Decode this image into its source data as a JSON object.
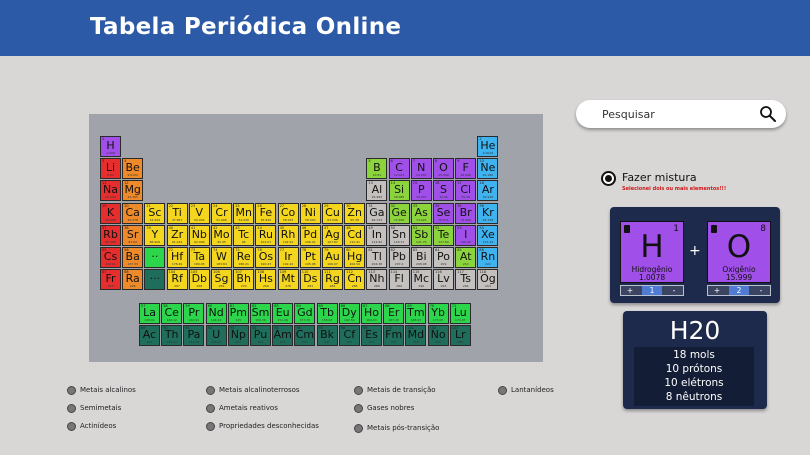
{
  "app": {
    "title": "Tabela Periódica Online"
  },
  "search": {
    "placeholder": "Pesquisar"
  },
  "colors": {
    "header": "#2d5aa6",
    "page_bg": "#d9d6d6",
    "table_panel": "#a1a3ab",
    "mix_panel": "#1e2a4b",
    "categories": {
      "reactive_nonmetal": "#a04fe8",
      "alkali": "#e72e2e",
      "alkaline_earth": "#ef8a2a",
      "transition": "#f5d61f",
      "post_transition": "#c4c0bd",
      "metalloid": "#8cd43c",
      "halogen": "#a04fe8",
      "noble_gas": "#3fb3f0",
      "lanthanide": "#2bd64a",
      "actinide": "#1f6e5c",
      "unknown": "#2ab650"
    }
  },
  "periodic_table": {
    "main": [
      {
        "z": 1,
        "s": "H",
        "m": "1.008",
        "c": "reactive_nonmetal",
        "col": 1,
        "row": 1
      },
      {
        "z": 2,
        "s": "He",
        "m": "4.0026",
        "c": "noble_gas",
        "col": 18,
        "row": 1
      },
      {
        "z": 3,
        "s": "Li",
        "m": "6.94",
        "c": "alkali",
        "col": 1,
        "row": 2
      },
      {
        "z": 4,
        "s": "Be",
        "m": "9.0122",
        "c": "alkaline_earth",
        "col": 2,
        "row": 2
      },
      {
        "z": 5,
        "s": "B",
        "m": "10.81",
        "c": "metalloid",
        "col": 13,
        "row": 2
      },
      {
        "z": 6,
        "s": "C",
        "m": "12.011",
        "c": "reactive_nonmetal",
        "col": 14,
        "row": 2
      },
      {
        "z": 7,
        "s": "N",
        "m": "14.007",
        "c": "reactive_nonmetal",
        "col": 15,
        "row": 2
      },
      {
        "z": 8,
        "s": "O",
        "m": "15.999",
        "c": "reactive_nonmetal",
        "col": 16,
        "row": 2
      },
      {
        "z": 9,
        "s": "F",
        "m": "18.998",
        "c": "halogen",
        "col": 17,
        "row": 2
      },
      {
        "z": 10,
        "s": "Ne",
        "m": "20.180",
        "c": "noble_gas",
        "col": 18,
        "row": 2
      },
      {
        "z": 11,
        "s": "Na",
        "m": "22.990",
        "c": "alkali",
        "col": 1,
        "row": 3
      },
      {
        "z": 12,
        "s": "Mg",
        "m": "24.305",
        "c": "alkaline_earth",
        "col": 2,
        "row": 3
      },
      {
        "z": 13,
        "s": "Al",
        "m": "26.982",
        "c": "post_transition",
        "col": 13,
        "row": 3
      },
      {
        "z": 14,
        "s": "Si",
        "m": "28.085",
        "c": "metalloid",
        "col": 14,
        "row": 3
      },
      {
        "z": 15,
        "s": "P",
        "m": "30.974",
        "c": "reactive_nonmetal",
        "col": 15,
        "row": 3
      },
      {
        "z": 16,
        "s": "S",
        "m": "32.06",
        "c": "reactive_nonmetal",
        "col": 16,
        "row": 3
      },
      {
        "z": 17,
        "s": "Cl",
        "m": "35.45",
        "c": "halogen",
        "col": 17,
        "row": 3
      },
      {
        "z": 18,
        "s": "Ar",
        "m": "39.948",
        "c": "noble_gas",
        "col": 18,
        "row": 3
      },
      {
        "z": 19,
        "s": "K",
        "m": "39.098",
        "c": "alkali",
        "col": 1,
        "row": 4
      },
      {
        "z": 20,
        "s": "Ca",
        "m": "40.078",
        "c": "alkaline_earth",
        "col": 2,
        "row": 4
      },
      {
        "z": 21,
        "s": "Sc",
        "m": "44.956",
        "c": "transition",
        "col": 3,
        "row": 4
      },
      {
        "z": 22,
        "s": "Ti",
        "m": "47.867",
        "c": "transition",
        "col": 4,
        "row": 4
      },
      {
        "z": 23,
        "s": "V",
        "m": "50.942",
        "c": "transition",
        "col": 5,
        "row": 4
      },
      {
        "z": 24,
        "s": "Cr",
        "m": "51.996",
        "c": "transition",
        "col": 6,
        "row": 4
      },
      {
        "z": 25,
        "s": "Mn",
        "m": "54.938",
        "c": "transition",
        "col": 7,
        "row": 4
      },
      {
        "z": 26,
        "s": "Fe",
        "m": "55.845",
        "c": "transition",
        "col": 8,
        "row": 4
      },
      {
        "z": 27,
        "s": "Co",
        "m": "58.933",
        "c": "transition",
        "col": 9,
        "row": 4
      },
      {
        "z": 28,
        "s": "Ni",
        "m": "58.693",
        "c": "transition",
        "col": 10,
        "row": 4
      },
      {
        "z": 29,
        "s": "Cu",
        "m": "63.546",
        "c": "transition",
        "col": 11,
        "row": 4
      },
      {
        "z": 30,
        "s": "Zn",
        "m": "65.38",
        "c": "transition",
        "col": 12,
        "row": 4
      },
      {
        "z": 31,
        "s": "Ga",
        "m": "69.723",
        "c": "post_transition",
        "col": 13,
        "row": 4
      },
      {
        "z": 32,
        "s": "Ge",
        "m": "72.630",
        "c": "metalloid",
        "col": 14,
        "row": 4
      },
      {
        "z": 33,
        "s": "As",
        "m": "74.922",
        "c": "metalloid",
        "col": 15,
        "row": 4
      },
      {
        "z": 34,
        "s": "Se",
        "m": "78.971",
        "c": "reactive_nonmetal",
        "col": 16,
        "row": 4
      },
      {
        "z": 35,
        "s": "Br",
        "m": "79.904",
        "c": "halogen",
        "col": 17,
        "row": 4
      },
      {
        "z": 36,
        "s": "Kr",
        "m": "83.798",
        "c": "noble_gas",
        "col": 18,
        "row": 4
      },
      {
        "z": 37,
        "s": "Rb",
        "m": "85.468",
        "c": "alkali",
        "col": 1,
        "row": 5
      },
      {
        "z": 38,
        "s": "Sr",
        "m": "87.62",
        "c": "alkaline_earth",
        "col": 2,
        "row": 5
      },
      {
        "z": 39,
        "s": "Y",
        "m": "88.906",
        "c": "transition",
        "col": 3,
        "row": 5
      },
      {
        "z": 40,
        "s": "Zr",
        "m": "91.224",
        "c": "transition",
        "col": 4,
        "row": 5
      },
      {
        "z": 41,
        "s": "Nb",
        "m": "92.906",
        "c": "transition",
        "col": 5,
        "row": 5
      },
      {
        "z": 42,
        "s": "Mo",
        "m": "95.95",
        "c": "transition",
        "col": 6,
        "row": 5
      },
      {
        "z": 43,
        "s": "Tc",
        "m": "98",
        "c": "transition",
        "col": 7,
        "row": 5
      },
      {
        "z": 44,
        "s": "Ru",
        "m": "101.07",
        "c": "transition",
        "col": 8,
        "row": 5
      },
      {
        "z": 45,
        "s": "Rh",
        "m": "102.91",
        "c": "transition",
        "col": 9,
        "row": 5
      },
      {
        "z": 46,
        "s": "Pd",
        "m": "106.42",
        "c": "transition",
        "col": 10,
        "row": 5
      },
      {
        "z": 47,
        "s": "Ag",
        "m": "107.87",
        "c": "transition",
        "col": 11,
        "row": 5
      },
      {
        "z": 48,
        "s": "Cd",
        "m": "112.41",
        "c": "transition",
        "col": 12,
        "row": 5
      },
      {
        "z": 49,
        "s": "In",
        "m": "114.82",
        "c": "post_transition",
        "col": 13,
        "row": 5
      },
      {
        "z": 50,
        "s": "Sn",
        "m": "118.71",
        "c": "post_transition",
        "col": 14,
        "row": 5
      },
      {
        "z": 51,
        "s": "Sb",
        "m": "121.76",
        "c": "metalloid",
        "col": 15,
        "row": 5
      },
      {
        "z": 52,
        "s": "Te",
        "m": "127.60",
        "c": "metalloid",
        "col": 16,
        "row": 5
      },
      {
        "z": 53,
        "s": "I",
        "m": "126.90",
        "c": "halogen",
        "col": 17,
        "row": 5
      },
      {
        "z": 54,
        "s": "Xe",
        "m": "131.29",
        "c": "noble_gas",
        "col": 18,
        "row": 5
      },
      {
        "z": 55,
        "s": "Cs",
        "m": "132.91",
        "c": "alkali",
        "col": 1,
        "row": 6
      },
      {
        "z": 56,
        "s": "Ba",
        "m": "137.33",
        "c": "alkaline_earth",
        "col": 2,
        "row": 6
      },
      {
        "z": "",
        "s": "··",
        "m": "",
        "c": "lanthanide",
        "col": 3,
        "row": 6
      },
      {
        "z": 72,
        "s": "Hf",
        "m": "178.49",
        "c": "transition",
        "col": 4,
        "row": 6
      },
      {
        "z": 73,
        "s": "Ta",
        "m": "180.95",
        "c": "transition",
        "col": 5,
        "row": 6
      },
      {
        "z": 74,
        "s": "W",
        "m": "183.84",
        "c": "transition",
        "col": 6,
        "row": 6
      },
      {
        "z": 75,
        "s": "Re",
        "m": "186.21",
        "c": "transition",
        "col": 7,
        "row": 6
      },
      {
        "z": 76,
        "s": "Os",
        "m": "190.23",
        "c": "transition",
        "col": 8,
        "row": 6
      },
      {
        "z": 77,
        "s": "Ir",
        "m": "192.22",
        "c": "transition",
        "col": 9,
        "row": 6
      },
      {
        "z": 78,
        "s": "Pt",
        "m": "195.08",
        "c": "transition",
        "col": 10,
        "row": 6
      },
      {
        "z": 79,
        "s": "Au",
        "m": "196.97",
        "c": "transition",
        "col": 11,
        "row": 6
      },
      {
        "z": 80,
        "s": "Hg",
        "m": "200.59",
        "c": "transition",
        "col": 12,
        "row": 6
      },
      {
        "z": 81,
        "s": "Tl",
        "m": "204.38",
        "c": "post_transition",
        "col": 13,
        "row": 6
      },
      {
        "z": 82,
        "s": "Pb",
        "m": "207.2",
        "c": "post_transition",
        "col": 14,
        "row": 6
      },
      {
        "z": 83,
        "s": "Bi",
        "m": "208.98",
        "c": "post_transition",
        "col": 15,
        "row": 6
      },
      {
        "z": 84,
        "s": "Po",
        "m": "209",
        "c": "post_transition",
        "col": 16,
        "row": 6
      },
      {
        "z": 85,
        "s": "At",
        "m": "210",
        "c": "metalloid",
        "col": 17,
        "row": 6
      },
      {
        "z": 86,
        "s": "Rn",
        "m": "222",
        "c": "noble_gas",
        "col": 18,
        "row": 6
      },
      {
        "z": 87,
        "s": "Fr",
        "m": "223",
        "c": "alkali",
        "col": 1,
        "row": 7
      },
      {
        "z": 88,
        "s": "Ra",
        "m": "226",
        "c": "alkaline_earth",
        "col": 2,
        "row": 7
      },
      {
        "z": "",
        "s": "···",
        "m": "",
        "c": "actinide",
        "col": 3,
        "row": 7
      },
      {
        "z": 104,
        "s": "Rf",
        "m": "267",
        "c": "transition",
        "col": 4,
        "row": 7
      },
      {
        "z": 105,
        "s": "Db",
        "m": "268",
        "c": "transition",
        "col": 5,
        "row": 7
      },
      {
        "z": 106,
        "s": "Sg",
        "m": "269",
        "c": "transition",
        "col": 6,
        "row": 7
      },
      {
        "z": 107,
        "s": "Bh",
        "m": "270",
        "c": "transition",
        "col": 7,
        "row": 7
      },
      {
        "z": 108,
        "s": "Hs",
        "m": "269",
        "c": "transition",
        "col": 8,
        "row": 7
      },
      {
        "z": 109,
        "s": "Mt",
        "m": "278",
        "c": "transition",
        "col": 9,
        "row": 7
      },
      {
        "z": 110,
        "s": "Ds",
        "m": "281",
        "c": "transition",
        "col": 10,
        "row": 7
      },
      {
        "z": 111,
        "s": "Rg",
        "m": "282",
        "c": "transition",
        "col": 11,
        "row": 7
      },
      {
        "z": 112,
        "s": "Cn",
        "m": "285",
        "c": "transition",
        "col": 12,
        "row": 7
      },
      {
        "z": 113,
        "s": "Nh",
        "m": "286",
        "c": "post_transition",
        "col": 13,
        "row": 7
      },
      {
        "z": 114,
        "s": "Fl",
        "m": "289",
        "c": "post_transition",
        "col": 14,
        "row": 7
      },
      {
        "z": 115,
        "s": "Mc",
        "m": "290",
        "c": "post_transition",
        "col": 15,
        "row": 7
      },
      {
        "z": 116,
        "s": "Lv",
        "m": "293",
        "c": "post_transition",
        "col": 16,
        "row": 7
      },
      {
        "z": 117,
        "s": "Ts",
        "m": "294",
        "c": "post_transition",
        "col": 17,
        "row": 7
      },
      {
        "z": 118,
        "s": "Og",
        "m": "294",
        "c": "post_transition",
        "col": 18,
        "row": 7
      }
    ],
    "f_block": [
      {
        "z": 57,
        "s": "La",
        "m": "138.91",
        "c": "lanthanide",
        "col": 0,
        "row": 0
      },
      {
        "z": 58,
        "s": "Ce",
        "m": "140.12",
        "c": "lanthanide",
        "col": 1,
        "row": 0
      },
      {
        "z": 59,
        "s": "Pr",
        "m": "140.91",
        "c": "lanthanide",
        "col": 2,
        "row": 0
      },
      {
        "z": 60,
        "s": "Nd",
        "m": "144.24",
        "c": "lanthanide",
        "col": 3,
        "row": 0
      },
      {
        "z": 61,
        "s": "Pm",
        "m": "145",
        "c": "lanthanide",
        "col": 4,
        "row": 0
      },
      {
        "z": 62,
        "s": "Sm",
        "m": "150.36",
        "c": "lanthanide",
        "col": 5,
        "row": 0
      },
      {
        "z": 63,
        "s": "Eu",
        "m": "151.96",
        "c": "lanthanide",
        "col": 6,
        "row": 0
      },
      {
        "z": 64,
        "s": "Gd",
        "m": "157.25",
        "c": "lanthanide",
        "col": 7,
        "row": 0
      },
      {
        "z": 65,
        "s": "Tb",
        "m": "158.93",
        "c": "lanthanide",
        "col": 8,
        "row": 0
      },
      {
        "z": 66,
        "s": "Dy",
        "m": "162.50",
        "c": "lanthanide",
        "col": 9,
        "row": 0
      },
      {
        "z": 67,
        "s": "Ho",
        "m": "164.93",
        "c": "lanthanide",
        "col": 10,
        "row": 0
      },
      {
        "z": 68,
        "s": "Er",
        "m": "167.26",
        "c": "lanthanide",
        "col": 11,
        "row": 0
      },
      {
        "z": 69,
        "s": "Tm",
        "m": "168.93",
        "c": "lanthanide",
        "col": 12,
        "row": 0
      },
      {
        "z": 70,
        "s": "Yb",
        "m": "173.05",
        "c": "lanthanide",
        "col": 13,
        "row": 0
      },
      {
        "z": 71,
        "s": "Lu",
        "m": "174.97",
        "c": "lanthanide",
        "col": 14,
        "row": 0
      },
      {
        "z": 89,
        "s": "Ac",
        "m": "227",
        "c": "actinide",
        "col": 0,
        "row": 1
      },
      {
        "z": 90,
        "s": "Th",
        "m": "232.04",
        "c": "actinide",
        "col": 1,
        "row": 1
      },
      {
        "z": 91,
        "s": "Pa",
        "m": "231.04",
        "c": "actinide",
        "col": 2,
        "row": 1
      },
      {
        "z": 92,
        "s": "U",
        "m": "238.03",
        "c": "actinide",
        "col": 3,
        "row": 1
      },
      {
        "z": 93,
        "s": "Np",
        "m": "237",
        "c": "actinide",
        "col": 4,
        "row": 1
      },
      {
        "z": 94,
        "s": "Pu",
        "m": "244",
        "c": "actinide",
        "col": 5,
        "row": 1
      },
      {
        "z": 95,
        "s": "Am",
        "m": "243",
        "c": "actinide",
        "col": 6,
        "row": 1
      },
      {
        "z": 96,
        "s": "Cm",
        "m": "247",
        "c": "actinide",
        "col": 7,
        "row": 1
      },
      {
        "z": 97,
        "s": "Bk",
        "m": "247",
        "c": "actinide",
        "col": 8,
        "row": 1
      },
      {
        "z": 98,
        "s": "Cf",
        "m": "251",
        "c": "actinide",
        "col": 9,
        "row": 1
      },
      {
        "z": 99,
        "s": "Es",
        "m": "252",
        "c": "actinide",
        "col": 10,
        "row": 1
      },
      {
        "z": 100,
        "s": "Fm",
        "m": "257",
        "c": "actinide",
        "col": 11,
        "row": 1
      },
      {
        "z": 101,
        "s": "Md",
        "m": "258",
        "c": "actinide",
        "col": 12,
        "row": 1
      },
      {
        "z": 102,
        "s": "No",
        "m": "259",
        "c": "actinide",
        "col": 13,
        "row": 1
      },
      {
        "z": 103,
        "s": "Lr",
        "m": "266",
        "c": "actinide",
        "col": 14,
        "row": 1
      }
    ]
  },
  "mix": {
    "label": "Fazer mistura",
    "warning": "Selecionei dois ou mais elementos!!!",
    "plus": "+",
    "elements": [
      {
        "symbol": "H",
        "number": "1",
        "name": "Hidrogênio",
        "mass": "1.0078",
        "count": "1",
        "inc": "+",
        "dec": "-"
      },
      {
        "symbol": "O",
        "number": "8",
        "name": "Oxigênio",
        "mass": "15.999",
        "count": "2",
        "inc": "+",
        "dec": "-"
      }
    ]
  },
  "result": {
    "formula": "H20",
    "stats": [
      "18 mols",
      "10 prótons",
      "10 elétrons",
      "8 nêutrons"
    ]
  },
  "legend": [
    "Metais alcalinos",
    "Metais alcalinoterrosos",
    "Metais de transição",
    "Lantanídeos",
    "Semimetais",
    "Ametais reativos",
    "Gases nobres",
    "Actinídeos",
    "Propriedades desconhecidas",
    "Metais pós-transição"
  ]
}
